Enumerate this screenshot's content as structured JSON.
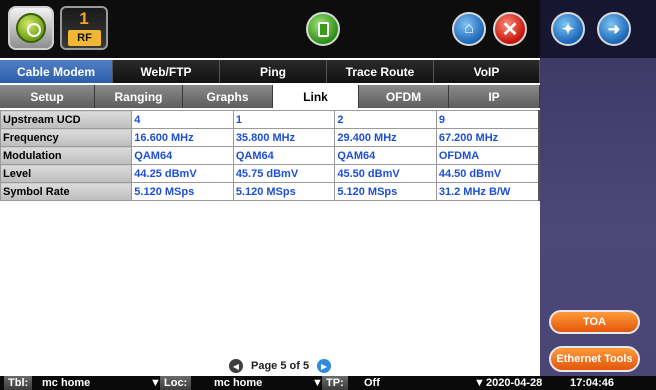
{
  "header": {
    "rf_number": "1",
    "rf_label": "RF"
  },
  "tabs_main": [
    {
      "label": "Cable Modem",
      "active": true
    },
    {
      "label": "Web/FTP",
      "active": false
    },
    {
      "label": "Ping",
      "active": false
    },
    {
      "label": "Trace Route",
      "active": false
    },
    {
      "label": "VoIP",
      "active": false
    }
  ],
  "tabs_sub": [
    {
      "label": "Setup",
      "active": false
    },
    {
      "label": "Ranging",
      "active": false
    },
    {
      "label": "Graphs",
      "active": false
    },
    {
      "label": "Link",
      "active": true
    },
    {
      "label": "OFDM",
      "active": false
    },
    {
      "label": "IP",
      "active": false
    }
  ],
  "table": {
    "rows": [
      {
        "label": "Upstream UCD",
        "values": [
          "4",
          "1",
          "2",
          "9"
        ]
      },
      {
        "label": "Frequency",
        "values": [
          "16.600 MHz",
          "35.800 MHz",
          "29.400 MHz",
          "67.200 MHz"
        ]
      },
      {
        "label": "Modulation",
        "values": [
          "QAM64",
          "QAM64",
          "QAM64",
          "OFDMA"
        ]
      },
      {
        "label": "Level",
        "values": [
          "44.25 dBmV",
          "45.75 dBmV",
          "45.50 dBmV",
          "44.50 dBmV"
        ]
      },
      {
        "label": "Symbol Rate",
        "values": [
          "5.120 MSps",
          "5.120 MSps",
          "5.120 MSps",
          "31.2 MHz B/W"
        ]
      }
    ]
  },
  "pager": {
    "text": "Page 5 of 5"
  },
  "side_buttons": {
    "toa": "TOA",
    "ethernet_tools": "Ethernet Tools"
  },
  "status_bar": {
    "tbl_key": "Tbl:",
    "tbl_value": "mc home",
    "loc_key": "Loc:",
    "loc_value": "mc home",
    "tp_key": "TP:",
    "tp_value": "Off",
    "date": "2020-04-28",
    "time": "17:04:46"
  },
  "colors": {
    "accent_tab": "#3a6db8",
    "value_text": "#1d4fd0",
    "orange_button": "#f07820",
    "side_panel": "#4a4574"
  }
}
